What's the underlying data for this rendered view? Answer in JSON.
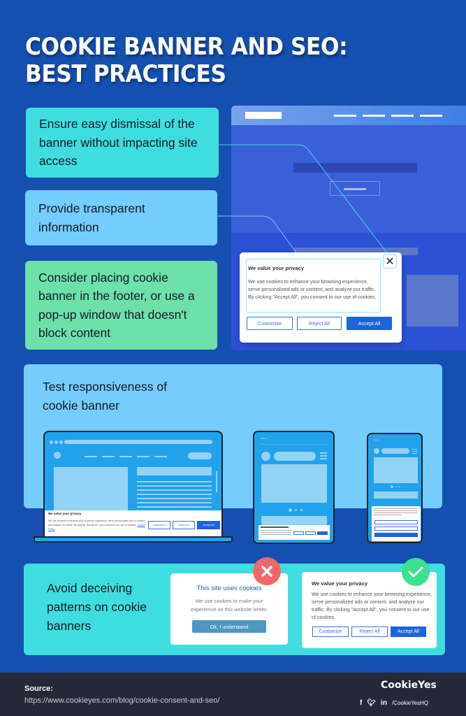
{
  "title": {
    "line1": "COOKIE BANNER AND SEO:",
    "line2": "BEST PRACTICES"
  },
  "tips": [
    {
      "text": "Ensure easy dismissal of the banner without impacting site access",
      "color": "#40dde0"
    },
    {
      "text": "Provide transparent information",
      "color": "#75cdfd"
    },
    {
      "text": "Consider placing cookie banner in the footer, or use a pop-up window that doesn't block content",
      "color": "#6ee1ab"
    }
  ],
  "consent_banner": {
    "title": "We value your privacy",
    "body": "We use cookies to enhance your browsing experience, serve personalized ads or content, and analyze our traffic. By clicking \"Accept All\", you consent to our use of cookies.",
    "close_icon": "close-icon",
    "buttons": {
      "customize": "Customize",
      "reject": "Reject All",
      "accept": "Accept All"
    }
  },
  "responsiveness": {
    "title": "Test responsiveness of cookie banner",
    "laptop_banner": {
      "title": "We value your privacy",
      "body": "We use cookies to enhance your browsing experience, serve personalized ads or content, and analyze our traffic. By clicking \"Accept All\", you consent to our use of cookies.",
      "link": "Cookie Policy",
      "customize": "Customize ▾",
      "reject": "Reject All",
      "accept": "Accept All"
    },
    "tablet_url": "https://",
    "phone_url": "https://"
  },
  "deceiving": {
    "title": "Avoid deceiving patterns on cookie banners",
    "bad_example": {
      "title": "This site uses cookies",
      "body": "We use cookies to make your experience on this website better.",
      "button": "Ok, I understand",
      "badge_icon": "x-icon",
      "badge_color": "#f2686a"
    },
    "good_example": {
      "title": "We value your privacy",
      "body": "We use cookies to enhance your browsing experience, serve personalized ads or content, and analyze our traffic. By clicking \"Accept All\", you consent to our use of cookies.",
      "customize": "Customize",
      "reject": "Reject All",
      "accept": "Accept All",
      "badge_icon": "check-icon",
      "badge_color": "#3ce08f"
    }
  },
  "footer": {
    "source_label": "Source:",
    "source_url": "https://www.cookieyes.com/blog/cookie-consent-and-seo/",
    "brand": "CookieYes",
    "social_icons": [
      "facebook-icon",
      "twitter-icon",
      "linkedin-icon"
    ],
    "handle": "/CookieYesHQ"
  },
  "colors": {
    "background": "#154fb0",
    "accent_blue": "#1d63dc",
    "footer": "#252839"
  }
}
